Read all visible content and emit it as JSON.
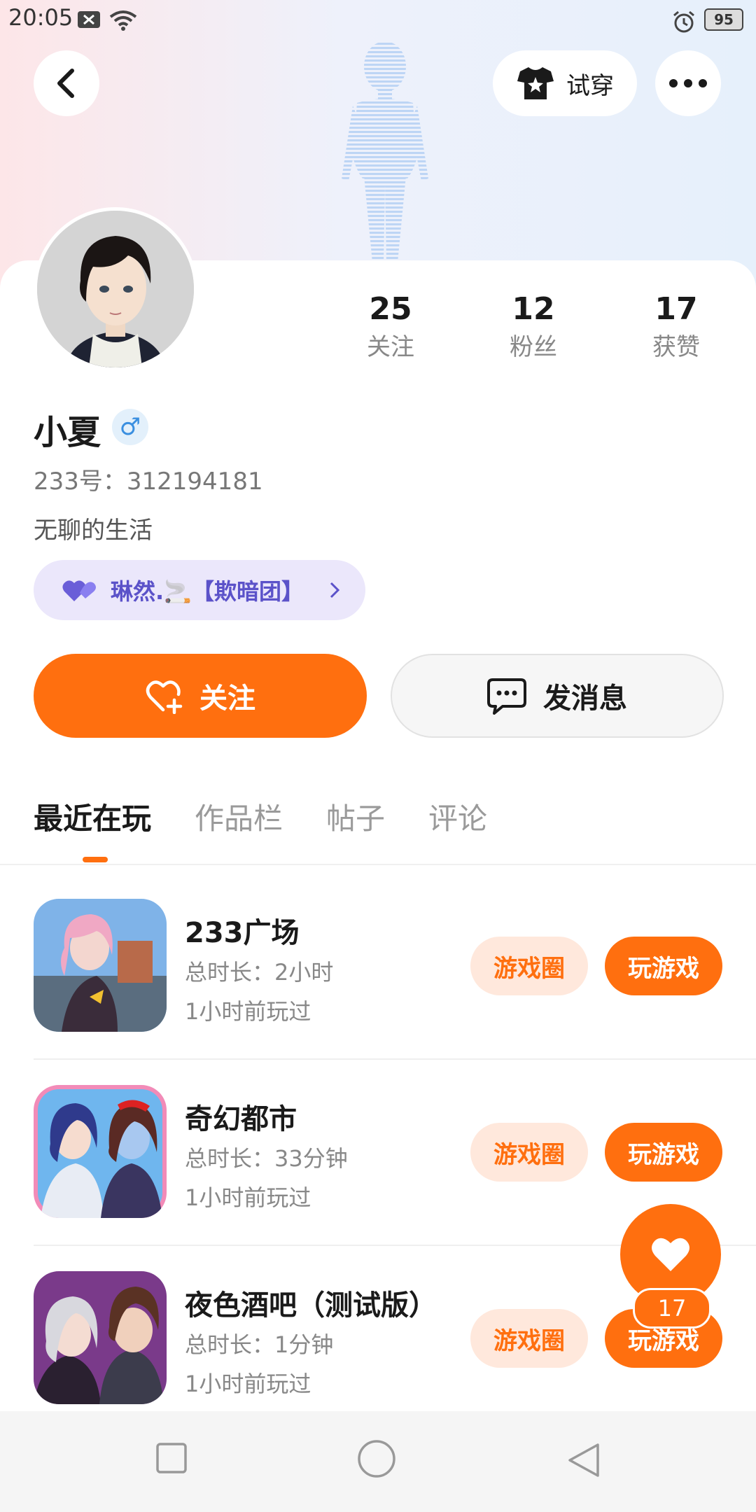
{
  "status_bar": {
    "time": "20:05",
    "battery": "95"
  },
  "header": {
    "try_on_label": "试穿"
  },
  "profile": {
    "stats": [
      {
        "value": "25",
        "label": "关注"
      },
      {
        "value": "12",
        "label": "粉丝"
      },
      {
        "value": "17",
        "label": "获赞"
      }
    ],
    "name": "小夏",
    "gender_symbol": "♂",
    "id_line": "233号：312194181",
    "bio": "无聊的生活",
    "family_text": "琳然.🚬【欺暗团】"
  },
  "actions": {
    "follow_label": "关注",
    "message_label": "发消息"
  },
  "tabs": [
    "最近在玩",
    "作品栏",
    "帖子",
    "评论"
  ],
  "games": [
    {
      "title": "233广场",
      "duration": "总时长：2小时",
      "last_played": "1小时前玩过",
      "circle_label": "游戏圈",
      "play_label": "玩游戏"
    },
    {
      "title": "奇幻都市",
      "duration": "总时长：33分钟",
      "last_played": "1小时前玩过",
      "circle_label": "游戏圈",
      "play_label": "玩游戏"
    },
    {
      "title": "夜色酒吧（测试版）",
      "duration": "总时长：1分钟",
      "last_played": "1小时前玩过",
      "circle_label": "游戏圈",
      "play_label": "玩游戏"
    }
  ],
  "like_fab": {
    "count": "17"
  },
  "colors": {
    "accent": "#ff6f0f",
    "family_text": "#5b52c9"
  }
}
